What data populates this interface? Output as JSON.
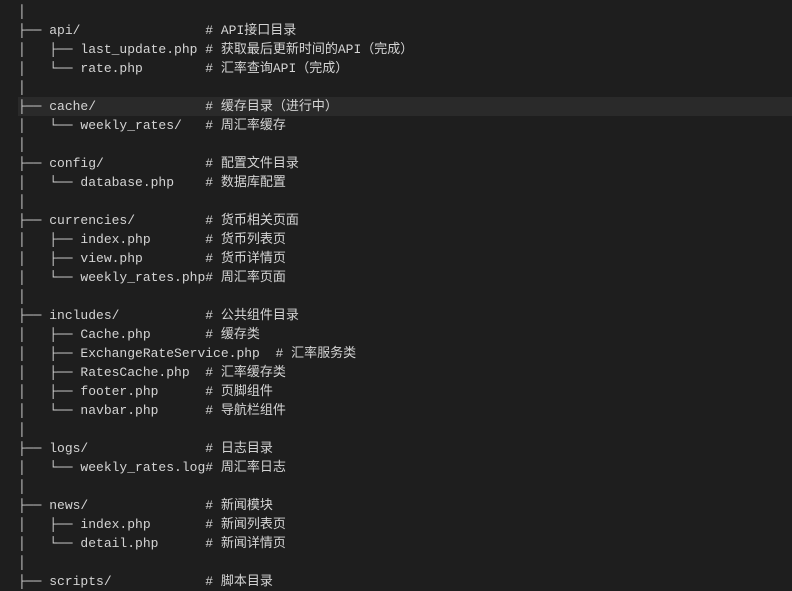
{
  "lines": [
    {
      "tree": "│",
      "spaces": "",
      "name": "",
      "pad": "",
      "hash": "",
      "comment": "",
      "highlighted": false
    },
    {
      "tree": "├── ",
      "spaces": "",
      "name": "api/",
      "pad": "                ",
      "hash": "# ",
      "comment": "API接口目录",
      "highlighted": false
    },
    {
      "tree": "│   ├── ",
      "spaces": "",
      "name": "last_update.php",
      "pad": " ",
      "hash": "# ",
      "comment": "获取最后更新时间的API（完成）",
      "highlighted": false
    },
    {
      "tree": "│   └── ",
      "spaces": "",
      "name": "rate.php",
      "pad": "        ",
      "hash": "# ",
      "comment": "汇率查询API（完成）",
      "highlighted": false
    },
    {
      "tree": "│",
      "spaces": "",
      "name": "",
      "pad": "",
      "hash": "",
      "comment": "",
      "highlighted": false
    },
    {
      "tree": "├── ",
      "spaces": "",
      "name": "cache/",
      "pad": "              ",
      "hash": "# ",
      "comment": "缓存目录（进行中）",
      "highlighted": true
    },
    {
      "tree": "│   └── ",
      "spaces": "",
      "name": "weekly_rates/",
      "pad": "   ",
      "hash": "# ",
      "comment": "周汇率缓存",
      "highlighted": false
    },
    {
      "tree": "│",
      "spaces": "",
      "name": "",
      "pad": "",
      "hash": "",
      "comment": "",
      "highlighted": false
    },
    {
      "tree": "├── ",
      "spaces": "",
      "name": "config/",
      "pad": "             ",
      "hash": "# ",
      "comment": "配置文件目录",
      "highlighted": false
    },
    {
      "tree": "│   └── ",
      "spaces": "",
      "name": "database.php",
      "pad": "    ",
      "hash": "# ",
      "comment": "数据库配置",
      "highlighted": false
    },
    {
      "tree": "│",
      "spaces": "",
      "name": "",
      "pad": "",
      "hash": "",
      "comment": "",
      "highlighted": false
    },
    {
      "tree": "├── ",
      "spaces": "",
      "name": "currencies/",
      "pad": "         ",
      "hash": "# ",
      "comment": "货币相关页面",
      "highlighted": false
    },
    {
      "tree": "│   ├── ",
      "spaces": "",
      "name": "index.php",
      "pad": "       ",
      "hash": "# ",
      "comment": "货币列表页",
      "highlighted": false
    },
    {
      "tree": "│   ├── ",
      "spaces": "",
      "name": "view.php",
      "pad": "        ",
      "hash": "# ",
      "comment": "货币详情页",
      "highlighted": false
    },
    {
      "tree": "│   └── ",
      "spaces": "",
      "name": "weekly_rates.php",
      "pad": "",
      "hash": "# ",
      "comment": "周汇率页面",
      "highlighted": false
    },
    {
      "tree": "│",
      "spaces": "",
      "name": "",
      "pad": "",
      "hash": "",
      "comment": "",
      "highlighted": false
    },
    {
      "tree": "├── ",
      "spaces": "",
      "name": "includes/",
      "pad": "           ",
      "hash": "# ",
      "comment": "公共组件目录",
      "highlighted": false
    },
    {
      "tree": "│   ├── ",
      "spaces": "",
      "name": "Cache.php",
      "pad": "       ",
      "hash": "# ",
      "comment": "缓存类",
      "highlighted": false
    },
    {
      "tree": "│   ├── ",
      "spaces": "",
      "name": "ExchangeRateService.php",
      "pad": "  ",
      "hash": "# ",
      "comment": "汇率服务类",
      "highlighted": false
    },
    {
      "tree": "│   ├── ",
      "spaces": "",
      "name": "RatesCache.php",
      "pad": "  ",
      "hash": "# ",
      "comment": "汇率缓存类",
      "highlighted": false
    },
    {
      "tree": "│   ├── ",
      "spaces": "",
      "name": "footer.php",
      "pad": "      ",
      "hash": "# ",
      "comment": "页脚组件",
      "highlighted": false
    },
    {
      "tree": "│   └── ",
      "spaces": "",
      "name": "navbar.php",
      "pad": "      ",
      "hash": "# ",
      "comment": "导航栏组件",
      "highlighted": false
    },
    {
      "tree": "│",
      "spaces": "",
      "name": "",
      "pad": "",
      "hash": "",
      "comment": "",
      "highlighted": false
    },
    {
      "tree": "├── ",
      "spaces": "",
      "name": "logs/",
      "pad": "               ",
      "hash": "# ",
      "comment": "日志目录",
      "highlighted": false
    },
    {
      "tree": "│   └── ",
      "spaces": "",
      "name": "weekly_rates.log",
      "pad": "",
      "hash": "# ",
      "comment": "周汇率日志",
      "highlighted": false
    },
    {
      "tree": "│",
      "spaces": "",
      "name": "",
      "pad": "",
      "hash": "",
      "comment": "",
      "highlighted": false
    },
    {
      "tree": "├── ",
      "spaces": "",
      "name": "news/",
      "pad": "               ",
      "hash": "# ",
      "comment": "新闻模块",
      "highlighted": false
    },
    {
      "tree": "│   ├── ",
      "spaces": "",
      "name": "index.php",
      "pad": "       ",
      "hash": "# ",
      "comment": "新闻列表页",
      "highlighted": false
    },
    {
      "tree": "│   └── ",
      "spaces": "",
      "name": "detail.php",
      "pad": "      ",
      "hash": "# ",
      "comment": "新闻详情页",
      "highlighted": false
    },
    {
      "tree": "│",
      "spaces": "",
      "name": "",
      "pad": "",
      "hash": "",
      "comment": "",
      "highlighted": false
    },
    {
      "tree": "├── ",
      "spaces": "",
      "name": "scripts/",
      "pad": "            ",
      "hash": "# ",
      "comment": "脚本目录",
      "highlighted": false
    }
  ]
}
